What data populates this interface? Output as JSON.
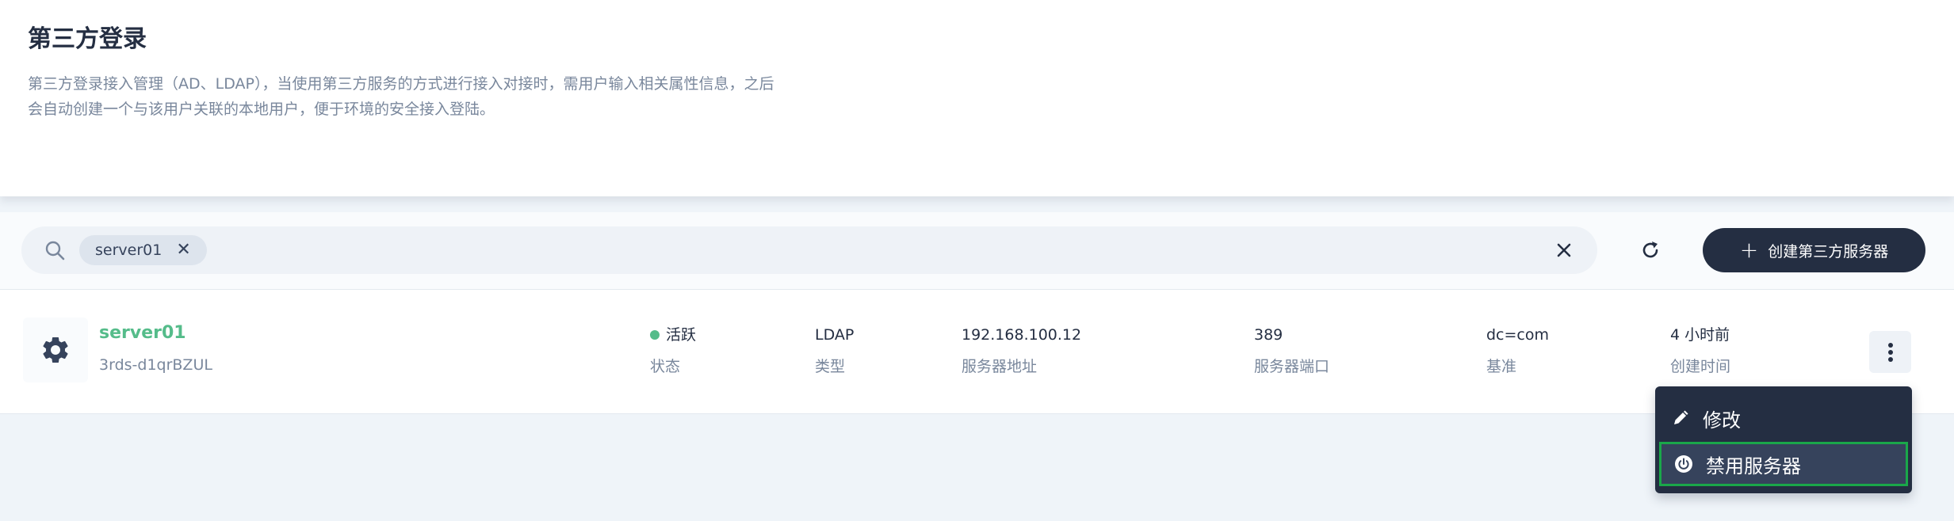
{
  "header": {
    "title": "第三方登录",
    "description": "第三方登录接入管理（AD、LDAP），当使用第三方服务的方式进行接入对接时，需用户输入相关属性信息，之后会自动创建一个与该用户关联的本地用户，便于环境的安全接入登陆。"
  },
  "toolbar": {
    "search_tag": "server01",
    "create_label": "创建第三方服务器"
  },
  "row": {
    "name": "server01",
    "id": "3rds-d1qrBZUL",
    "status": {
      "value": "活跃",
      "label": "状态",
      "color": "#55bc8a"
    },
    "type": {
      "value": "LDAP",
      "label": "类型"
    },
    "address": {
      "value": "192.168.100.12",
      "label": "服务器地址"
    },
    "port": {
      "value": "389",
      "label": "服务器端口"
    },
    "base": {
      "value": "dc=com",
      "label": "基准"
    },
    "created": {
      "value": "4 小时前",
      "label": "创建时间"
    }
  },
  "menu": {
    "items": [
      {
        "label": "修改",
        "icon": "pencil-icon"
      },
      {
        "label": "禁用服务器",
        "icon": "power-icon"
      }
    ]
  },
  "colors": {
    "accent_green": "#55bc8a",
    "dark": "#242e42",
    "highlight_border": "#1aa74a"
  }
}
